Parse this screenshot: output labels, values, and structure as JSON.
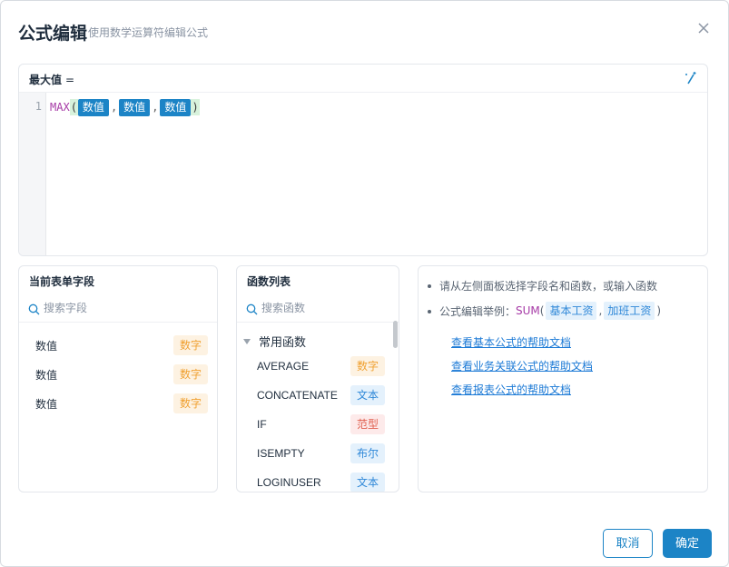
{
  "dialog": {
    "title": "公式编辑",
    "subtitle": "使用数学运算符编辑公式"
  },
  "editor": {
    "field_label": "最大值",
    "equals": "=",
    "line_number": "1",
    "formula": {
      "function": "MAX",
      "open_paren": "(",
      "close_paren": ")",
      "comma": ",",
      "args": [
        "数值",
        "数值",
        "数值"
      ]
    }
  },
  "fields_panel": {
    "title": "当前表单字段",
    "search_placeholder": "搜索字段",
    "items": [
      {
        "name": "数值",
        "type": "数字"
      },
      {
        "name": "数值",
        "type": "数字"
      },
      {
        "name": "数值",
        "type": "数字"
      }
    ]
  },
  "functions_panel": {
    "title": "函数列表",
    "search_placeholder": "搜索函数",
    "group": "常用函数",
    "items": [
      {
        "name": "AVERAGE",
        "type": "数字"
      },
      {
        "name": "CONCATENATE",
        "type": "文本"
      },
      {
        "name": "IF",
        "type": "范型"
      },
      {
        "name": "ISEMPTY",
        "type": "布尔"
      },
      {
        "name": "LOGINUSER",
        "type": "文本"
      }
    ]
  },
  "help_panel": {
    "tip": "请从左侧面板选择字段名和函数，或输入函数",
    "example_label": "公式编辑举例：",
    "example_fn": "SUM",
    "example_open": "(",
    "example_args": [
      "基本工资",
      "加班工资"
    ],
    "example_comma": ",",
    "example_close": ")",
    "links": [
      "查看基本公式的帮助文档",
      "查看业务关联公式的帮助文档",
      "查看报表公式的帮助文档"
    ]
  },
  "buttons": {
    "cancel": "取消",
    "ok": "确定"
  },
  "colors": {
    "primary": "#1c84c6",
    "function_name": "#a63aa6",
    "number_badge": "#f0a030",
    "text_badge": "#2f88d8",
    "range_badge": "#e06050"
  }
}
